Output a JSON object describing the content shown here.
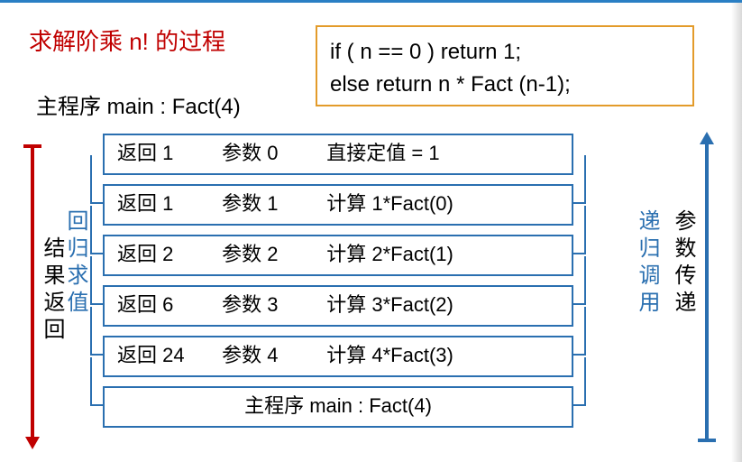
{
  "title": "求解阶乘 n! 的过程",
  "code": {
    "line1": "if ( n == 0 ) return 1;",
    "line2": "else return n * Fact (n-1);"
  },
  "main_call": "主程序 main : Fact(4)",
  "rows": [
    {
      "ret": "返回 1",
      "par": "参数 0",
      "calc": "直接定值 = 1"
    },
    {
      "ret": "返回 1",
      "par": "参数 1",
      "calc": "计算 1*Fact(0)"
    },
    {
      "ret": "返回 2",
      "par": "参数 2",
      "calc": "计算 2*Fact(1)"
    },
    {
      "ret": "返回 6",
      "par": "参数 3",
      "calc": "计算 3*Fact(2)"
    },
    {
      "ret": "返回 24",
      "par": "参数 4",
      "calc": "计算 4*Fact(3)"
    }
  ],
  "bottom_row": "主程序 main : Fact(4)",
  "labels": {
    "left_blue": "回归求值",
    "left_black": "结果返回",
    "right_blue": "递归调用",
    "right_black": "参数传递"
  }
}
